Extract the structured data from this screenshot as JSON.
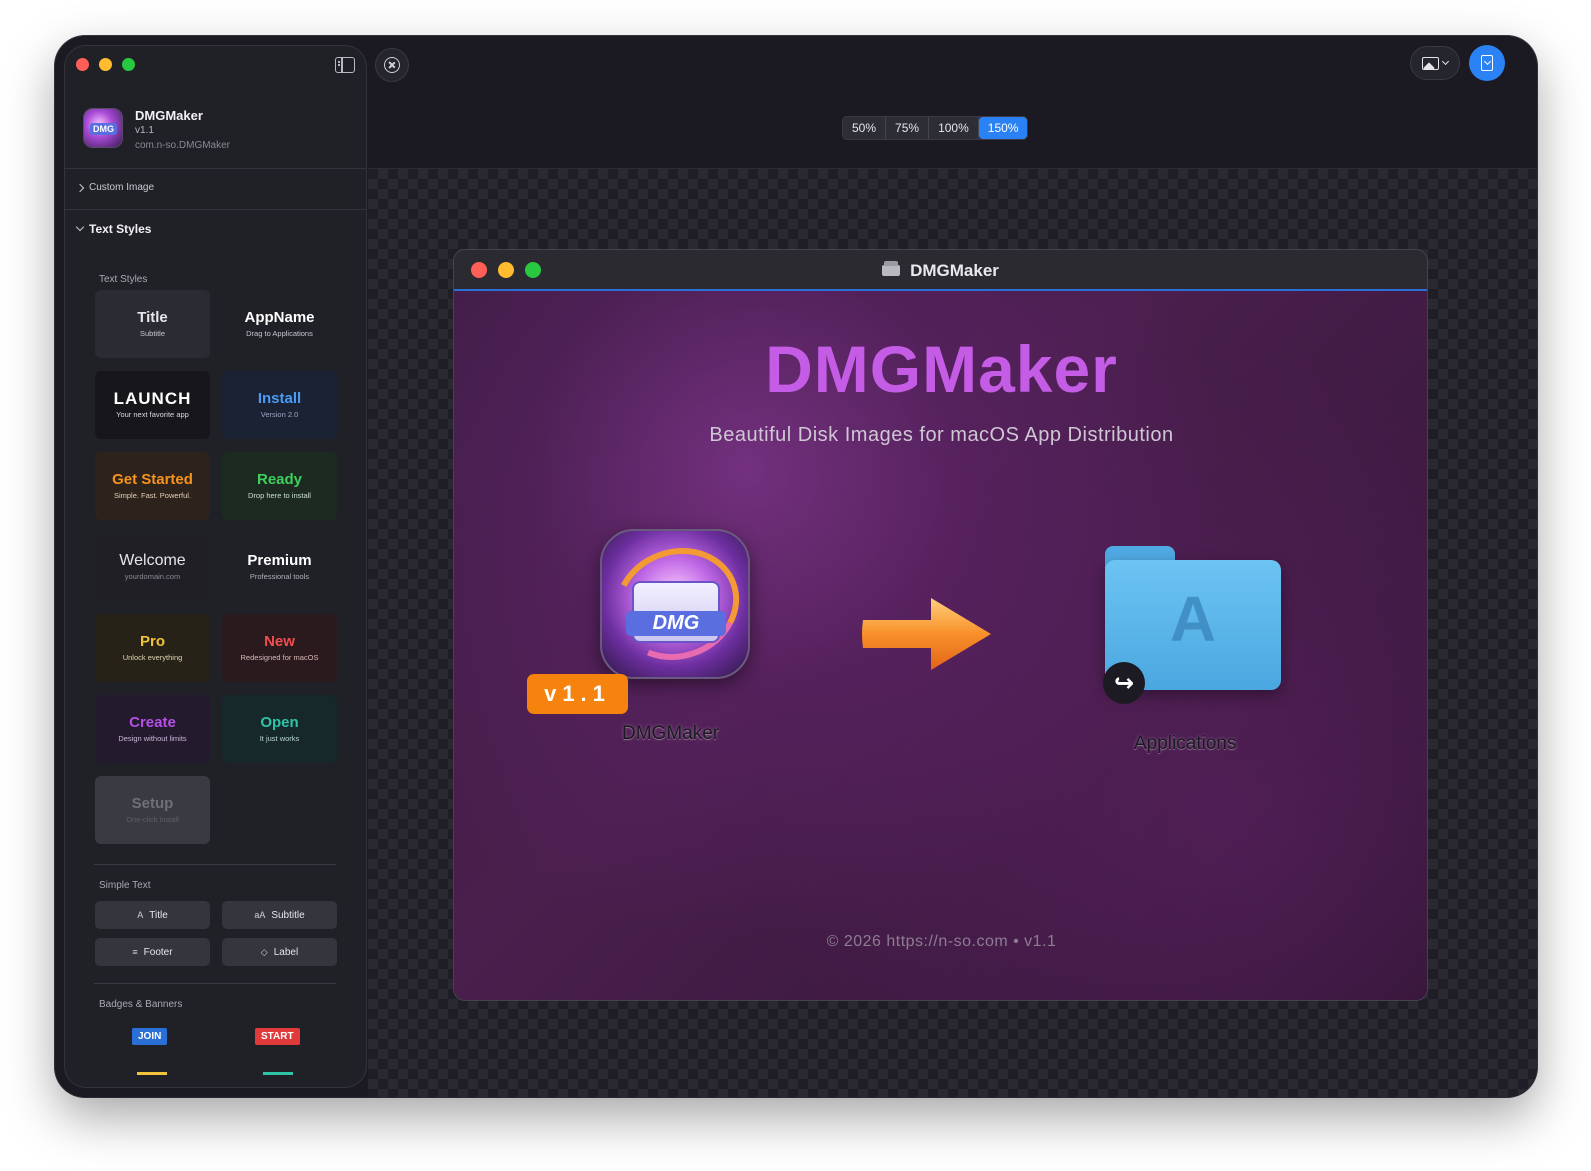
{
  "app": {
    "name": "DMGMaker",
    "version": "v1.1",
    "bundle_id": "com.n-so.DMGMaker"
  },
  "sidebar": {
    "custom_image_label": "Custom Image",
    "text_styles_header": "Text Styles",
    "text_styles_group_label": "Text Styles",
    "style_presets": [
      {
        "title": "Title",
        "subtitle": "Subtitle",
        "title_color": "#e6e6ea",
        "sub_color": "#c8c8d0",
        "bg": "#2b2b33"
      },
      {
        "title": "AppName",
        "subtitle": "Drag to Applications",
        "title_color": "#ffffff",
        "sub_color": "#c8c8d0",
        "bg": "#202027"
      },
      {
        "title": "LAUNCH",
        "subtitle": "Your next favorite app",
        "title_color": "#ffffff",
        "sub_color": "#d8d8de",
        "bg": "#16161b"
      },
      {
        "title": "Install",
        "subtitle": "Version 2.0",
        "title_color": "#4a9bf5",
        "sub_color": "#9aa6c0",
        "bg": "#1b2233"
      },
      {
        "title": "Get Started",
        "subtitle": "Simple. Fast. Powerful.",
        "title_color": "#f5941f",
        "sub_color": "#e6d0b8",
        "bg": "#2d221c"
      },
      {
        "title": "Ready",
        "subtitle": "Drop here to install",
        "title_color": "#3ecf5c",
        "sub_color": "#c7e0cc",
        "bg": "#1c2a22"
      },
      {
        "title": "Welcome",
        "subtitle": "yourdomain.com",
        "title_color": "#e6e6ea",
        "sub_color": "#8a8a94",
        "bg": "#1f1f25"
      },
      {
        "title": "Premium",
        "subtitle": "Professional tools",
        "title_color": "#ffffff",
        "sub_color": "#b0b0b8",
        "bg": "#202027"
      },
      {
        "title": "Pro",
        "subtitle": "Unlock everything",
        "title_color": "#f2c23a",
        "sub_color": "#e0d4b0",
        "bg": "#272218"
      },
      {
        "title": "New",
        "subtitle": "Redesigned for macOS",
        "title_color": "#f24d4d",
        "sub_color": "#d8b8b8",
        "bg": "#2a1a1d"
      },
      {
        "title": "Create",
        "subtitle": "Design without limits",
        "title_color": "#b54fe6",
        "sub_color": "#c9b8d8",
        "bg": "#231a2e"
      },
      {
        "title": "Open",
        "subtitle": "It just works",
        "title_color": "#2ec4a8",
        "sub_color": "#b8d8d0",
        "bg": "#17282a"
      },
      {
        "title": "Setup",
        "subtitle": "One-click install",
        "title_color": "#6f6f78",
        "sub_color": "#5f5f68",
        "bg": "#3a3a42"
      }
    ],
    "simple_text_label": "Simple Text",
    "simple_text_buttons": [
      {
        "icon": "A",
        "label": "Title"
      },
      {
        "icon": "aA",
        "label": "Subtitle"
      },
      {
        "icon": "≡",
        "label": "Footer"
      },
      {
        "icon": "◇",
        "label": "Label"
      }
    ],
    "badges_label": "Badges & Banners",
    "badges": [
      {
        "label": "JOIN",
        "bg": "#2a6fd6"
      },
      {
        "label": "START",
        "bg": "#e03a3a"
      }
    ]
  },
  "toolbar": {
    "zoom_levels": [
      "50%",
      "75%",
      "100%",
      "150%"
    ],
    "zoom_active": "150%"
  },
  "preview": {
    "window_title": "DMGMaker",
    "headline": "DMGMaker",
    "tagline": "Beautiful Disk Images for macOS App Distribution",
    "app_icon_text": "DMG",
    "version_tag": "v1.1",
    "app_caption": "DMGMaker",
    "folder_caption": "Applications",
    "footer": "© 2026 https://n-so.com • v1.1"
  },
  "colors": {
    "accent": "#2a82f5",
    "headline": "#c45ce6",
    "version_tag": "#f5830e",
    "selection_border": "#2d6fd8"
  }
}
